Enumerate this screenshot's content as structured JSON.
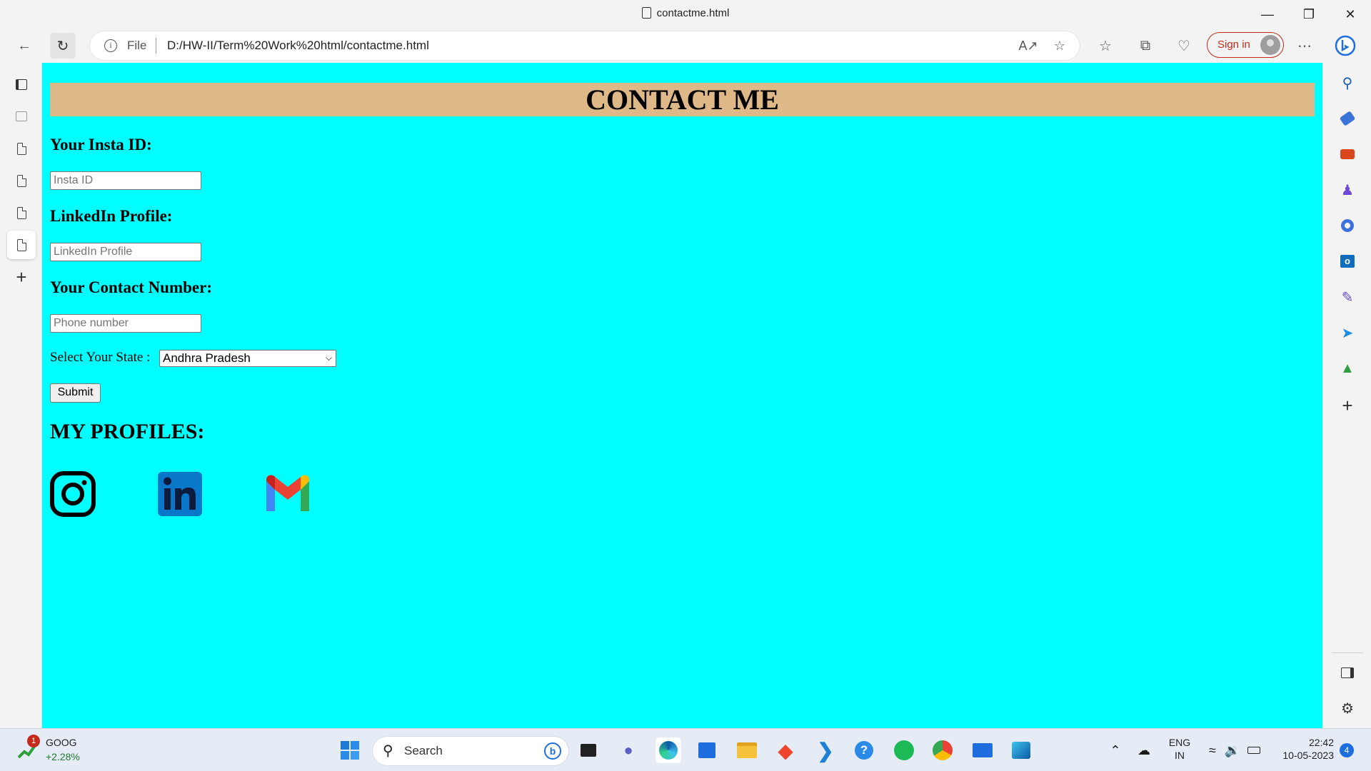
{
  "window": {
    "title": "contactme.html"
  },
  "toolbar": {
    "scheme_label": "File",
    "url": "D:/HW-II/Term%20Work%20html/contactme.html",
    "signin_label": "Sign in"
  },
  "page": {
    "heading": "CONTACT ME",
    "insta": {
      "label": "Your Insta ID:",
      "placeholder": "Insta ID"
    },
    "linkedin": {
      "label": "LinkedIn Profile:",
      "placeholder": "LinkedIn Profile"
    },
    "phone": {
      "label": "Your Contact Number:",
      "placeholder": "Phone number"
    },
    "state": {
      "label": "Select Your State :",
      "selected": "Andhra Pradesh"
    },
    "submit_label": "Submit",
    "profiles_heading": "MY PROFILES:"
  },
  "taskbar": {
    "stock": {
      "ticker": "GOOG",
      "change": "+2.28%",
      "badge": "1"
    },
    "search_label": "Search",
    "language": {
      "line1": "ENG",
      "line2": "IN"
    },
    "clock": {
      "time": "22:42",
      "date": "10-05-2023"
    },
    "notification_count": "4"
  },
  "colors": {
    "page_background": "#00ffff",
    "banner": "#deb887",
    "signin_accent": "#c42b1c"
  }
}
